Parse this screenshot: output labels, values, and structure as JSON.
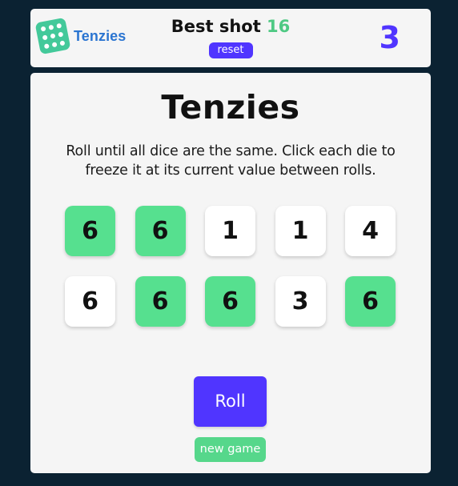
{
  "header": {
    "logo_text": "Tenzies",
    "logo_icon": "dice-icon",
    "best_label": "Best shot",
    "best_value": "16",
    "reset_label": "reset",
    "roll_count": "3"
  },
  "main": {
    "title": "Tenzies",
    "instructions": "Roll until all dice are the same. Click each die to freeze it at its current value between rolls.",
    "dice": [
      {
        "value": "6",
        "held": true
      },
      {
        "value": "6",
        "held": true
      },
      {
        "value": "1",
        "held": false
      },
      {
        "value": "1",
        "held": false
      },
      {
        "value": "4",
        "held": false
      },
      {
        "value": "6",
        "held": false
      },
      {
        "value": "6",
        "held": true
      },
      {
        "value": "6",
        "held": true
      },
      {
        "value": "3",
        "held": false
      },
      {
        "value": "6",
        "held": true
      }
    ],
    "roll_label": "Roll",
    "new_game_label": "new game"
  },
  "colors": {
    "background": "#0b2232",
    "card": "#f5f5f5",
    "accent": "#5035ff",
    "held": "#56e08f",
    "best_value": "#4ec983",
    "logo": "#2b75d1"
  }
}
